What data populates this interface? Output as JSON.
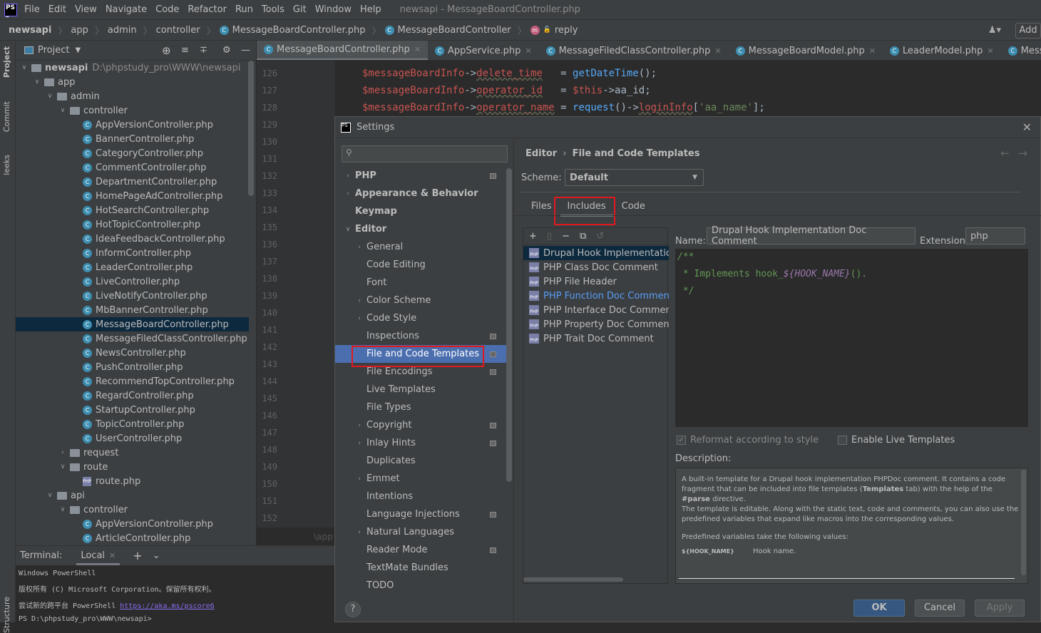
{
  "menubar": {
    "items": [
      "File",
      "Edit",
      "View",
      "Navigate",
      "Code",
      "Refactor",
      "Run",
      "Tools",
      "Git",
      "Window",
      "Help"
    ],
    "window_title": "newsapi - MessageBoardController.php"
  },
  "breadcrumb": {
    "items": [
      "newsapi",
      "app",
      "admin",
      "controller",
      "MessageBoardController.php",
      "MessageBoardController",
      "reply"
    ],
    "add_label": "Add"
  },
  "sidestrip": {
    "project": "Project",
    "commit": "Commit",
    "leeks": "leeks",
    "structure": "Structure"
  },
  "project_panel": {
    "title": "Project",
    "tree": [
      {
        "label": "newsapi",
        "level": 0,
        "type": "folder",
        "open": true,
        "path": "D:\\phpstudy_pro\\WWW\\newsapi"
      },
      {
        "label": "app",
        "level": 1,
        "type": "folder",
        "open": true
      },
      {
        "label": "admin",
        "level": 2,
        "type": "folder",
        "open": true
      },
      {
        "label": "controller",
        "level": 3,
        "type": "folder",
        "open": true
      },
      {
        "label": "AppVersionController.php",
        "level": 4,
        "type": "class"
      },
      {
        "label": "BannerController.php",
        "level": 4,
        "type": "class"
      },
      {
        "label": "CategoryController.php",
        "level": 4,
        "type": "class"
      },
      {
        "label": "CommentController.php",
        "level": 4,
        "type": "class"
      },
      {
        "label": "DepartmentController.php",
        "level": 4,
        "type": "class"
      },
      {
        "label": "HomePageAdController.php",
        "level": 4,
        "type": "class"
      },
      {
        "label": "HotSearchController.php",
        "level": 4,
        "type": "class"
      },
      {
        "label": "HotTopicController.php",
        "level": 4,
        "type": "class"
      },
      {
        "label": "IdeaFeedbackController.php",
        "level": 4,
        "type": "class"
      },
      {
        "label": "InformController.php",
        "level": 4,
        "type": "class"
      },
      {
        "label": "LeaderController.php",
        "level": 4,
        "type": "class"
      },
      {
        "label": "LiveController.php",
        "level": 4,
        "type": "class"
      },
      {
        "label": "LiveNotifyController.php",
        "level": 4,
        "type": "class"
      },
      {
        "label": "MbBannerController.php",
        "level": 4,
        "type": "class"
      },
      {
        "label": "MessageBoardController.php",
        "level": 4,
        "type": "class",
        "selected": true
      },
      {
        "label": "MessageFiledClassController.php",
        "level": 4,
        "type": "class"
      },
      {
        "label": "NewsController.php",
        "level": 4,
        "type": "class"
      },
      {
        "label": "PushController.php",
        "level": 4,
        "type": "class"
      },
      {
        "label": "RecommendTopController.php",
        "level": 4,
        "type": "class"
      },
      {
        "label": "RegardController.php",
        "level": 4,
        "type": "class"
      },
      {
        "label": "StartupController.php",
        "level": 4,
        "type": "class"
      },
      {
        "label": "TopicController.php",
        "level": 4,
        "type": "class"
      },
      {
        "label": "UserController.php",
        "level": 4,
        "type": "class"
      },
      {
        "label": "request",
        "level": 3,
        "type": "folder",
        "open": false
      },
      {
        "label": "route",
        "level": 3,
        "type": "folder",
        "open": true
      },
      {
        "label": "route.php",
        "level": 4,
        "type": "php"
      },
      {
        "label": "api",
        "level": 2,
        "type": "folder",
        "open": true
      },
      {
        "label": "controller",
        "level": 3,
        "type": "folder",
        "open": true
      },
      {
        "label": "AppVersionController.php",
        "level": 4,
        "type": "class"
      },
      {
        "label": "ArticleController.php",
        "level": 4,
        "type": "class"
      }
    ]
  },
  "editor_tabs": [
    {
      "label": "MessageBoardController.php",
      "active": true
    },
    {
      "label": "AppService.php"
    },
    {
      "label": "MessageFiledClassController.php"
    },
    {
      "label": "MessageBoardModel.php"
    },
    {
      "label": "LeaderModel.php"
    },
    {
      "label": "MessageBInfoCon"
    }
  ],
  "editor": {
    "line_numbers": [
      "126",
      "127",
      "128",
      "129",
      "130",
      "131",
      "132",
      "133",
      "134",
      "135",
      "136",
      "137",
      "138",
      "139",
      "140",
      "141",
      "142",
      "143",
      "144",
      "145",
      "146",
      "147",
      "148",
      "149",
      "150",
      "151",
      "152"
    ],
    "lines": [
      [
        [
          "tv",
          "$messageBoardInfo"
        ],
        [
          "pl",
          "->"
        ],
        [
          "kv",
          "delete_time"
        ],
        [
          "pl",
          "   = "
        ],
        [
          "fn",
          "getDateTime"
        ],
        [
          "pl",
          "();"
        ]
      ],
      [
        [
          "tv",
          "$messageBoardInfo"
        ],
        [
          "pl",
          "->"
        ],
        [
          "kv",
          "operator_id"
        ],
        [
          "pl",
          "   = "
        ],
        [
          "tv",
          "$this"
        ],
        [
          "pl",
          "->aa_id;"
        ]
      ],
      [
        [
          "tv",
          "$messageBoardInfo"
        ],
        [
          "pl",
          "->"
        ],
        [
          "kv",
          "operator_name"
        ],
        [
          "pl",
          " = "
        ],
        [
          "fn",
          "request"
        ],
        [
          "pl",
          "()->"
        ],
        [
          "kv",
          "loginInfo"
        ],
        [
          "pl",
          "["
        ],
        [
          "st",
          "'aa_name'"
        ],
        [
          "pl",
          "];"
        ]
      ]
    ],
    "breadcrumb_hint": "\\app"
  },
  "terminal": {
    "label": "Terminal:",
    "tab": "Local",
    "lines": [
      "Windows PowerShell",
      "版权所有 (C) Microsoft Corporation。保留所有权利。",
      "尝试新的跨平台 PowerShell "
    ],
    "link": "https://aka.ms/pscore6",
    "prompt": "PS D:\\phpstudy_pro\\WWW\\newsapi> "
  },
  "settings": {
    "title": "Settings",
    "search_placeholder": "",
    "nav": [
      {
        "label": "PHP",
        "level": 0,
        "arrow": "closed",
        "icon": true
      },
      {
        "label": "Appearance & Behavior",
        "level": 0,
        "arrow": "closed"
      },
      {
        "label": "Keymap",
        "level": 0
      },
      {
        "label": "Editor",
        "level": 0,
        "arrow": "open"
      },
      {
        "label": "General",
        "level": 1,
        "arrow": "closed"
      },
      {
        "label": "Code Editing",
        "level": 1
      },
      {
        "label": "Font",
        "level": 1
      },
      {
        "label": "Color Scheme",
        "level": 1,
        "arrow": "closed"
      },
      {
        "label": "Code Style",
        "level": 1,
        "arrow": "closed"
      },
      {
        "label": "Inspections",
        "level": 1,
        "icon": true
      },
      {
        "label": "File and Code Templates",
        "level": 1,
        "icon": true,
        "selected": true
      },
      {
        "label": "File Encodings",
        "level": 1,
        "icon": true
      },
      {
        "label": "Live Templates",
        "level": 1
      },
      {
        "label": "File Types",
        "level": 1
      },
      {
        "label": "Copyright",
        "level": 1,
        "arrow": "closed",
        "icon": true
      },
      {
        "label": "Inlay Hints",
        "level": 1,
        "arrow": "closed",
        "icon": true
      },
      {
        "label": "Duplicates",
        "level": 1
      },
      {
        "label": "Emmet",
        "level": 1,
        "arrow": "closed"
      },
      {
        "label": "Intentions",
        "level": 1
      },
      {
        "label": "Language Injections",
        "level": 1,
        "icon": true
      },
      {
        "label": "Natural Languages",
        "level": 1,
        "arrow": "closed"
      },
      {
        "label": "Reader Mode",
        "level": 1,
        "icon": true
      },
      {
        "label": "TextMate Bundles",
        "level": 1
      },
      {
        "label": "TODO",
        "level": 1
      }
    ],
    "crumb_parent": "Editor",
    "crumb_current": "File and Code Templates",
    "scheme_label": "Scheme:",
    "scheme_value": "Default",
    "tabs": [
      {
        "label": "Files"
      },
      {
        "label": "Includes",
        "active": true
      },
      {
        "label": "Code"
      }
    ],
    "templates": [
      {
        "label": "Drupal Hook Implementation Doc Comment",
        "selected": true
      },
      {
        "label": "PHP Class Doc Comment"
      },
      {
        "label": "PHP File Header"
      },
      {
        "label": "PHP Function Doc Comment",
        "modified": true
      },
      {
        "label": "PHP Interface Doc Comment"
      },
      {
        "label": "PHP Property Doc Comment"
      },
      {
        "label": "PHP Trait Doc Comment"
      }
    ],
    "name_label": "Name:",
    "name_value": "Drupal Hook Implementation Doc Comment",
    "ext_label": "Extension:",
    "ext_value": "php",
    "template_code": {
      "l1": "/**",
      "l2a": " * Implements hook_",
      "l2b": "${HOOK_NAME}",
      "l2c": "().",
      "l3": " */"
    },
    "reformat_label": "Reformat according to style",
    "reformat_checked": true,
    "live_label": "Enable Live Templates",
    "live_checked": false,
    "description_label": "Description:",
    "description": {
      "p1a": "A built-in template for a Drupal hook implementation PHPDoc comment. It contains a code fragment that can be included into file templates (",
      "p1b": "Templates",
      "p1c": " tab) with the help of the ",
      "p1d": "#parse",
      "p1e": " directive.",
      "p2": "The template is editable. Along with the static text, code and comments, you can also use the predefined variables that expand like macros into the corresponding values.",
      "p3": "Predefined variables take the following values:",
      "var": "${HOOK_NAME}",
      "var_desc": "Hook name."
    },
    "ok": "OK",
    "cancel": "Cancel",
    "apply": "Apply",
    "help": "?",
    "accent": "#4b6eaf",
    "highlight_color": "#e0191f"
  }
}
